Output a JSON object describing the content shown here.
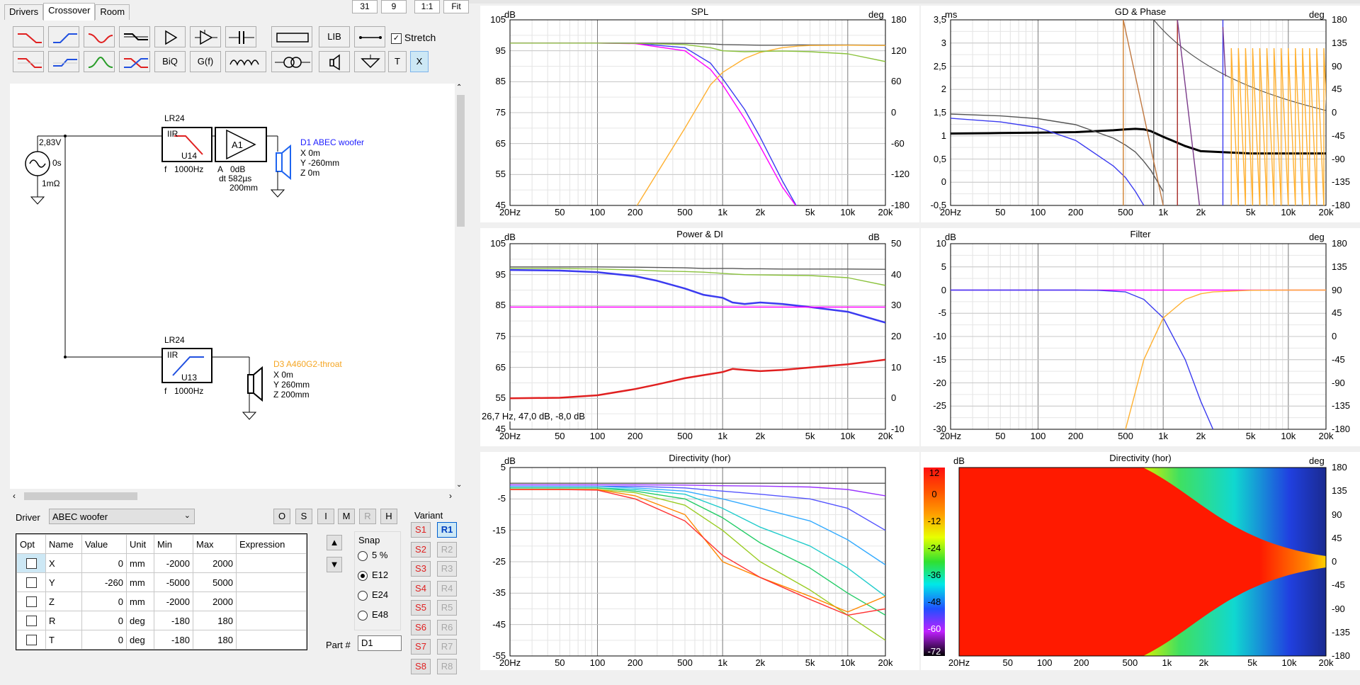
{
  "tabs": [
    "Drivers",
    "Crossover",
    "Room"
  ],
  "active_tab": "Crossover",
  "top_buttons": [
    "31",
    "9",
    "1:1",
    "Fit"
  ],
  "toolbar": {
    "row1": [
      "lowpass-icon",
      "highpass-icon",
      "bandstop-icon",
      "allpass-icon",
      "amplifier-icon",
      "buffer-icon",
      "capacitor-icon",
      "resistor-icon",
      "LIB",
      "wire-icon"
    ],
    "row2": [
      "lowpass2-icon",
      "shelf-icon",
      "bandpass-icon",
      "crossover-x-icon",
      "BiQ",
      "G(f)",
      "inductor-icon",
      "transformer-icon",
      "speaker-icon",
      "ground-icon",
      "T",
      "X"
    ],
    "stretch_label": "Stretch",
    "stretch_checked": true
  },
  "schematic": {
    "source": {
      "voltage": "2,83V",
      "delay": "0s",
      "impedance": "1mΩ"
    },
    "filter1": {
      "type": "LR24",
      "kind": "IIR",
      "unit": "U14",
      "freq_label": "f",
      "freq": "1000Hz"
    },
    "amp": {
      "label": "A1",
      "gain_label": "A",
      "gain": "0dB",
      "delay": "dt 582µs",
      "dist": "200mm"
    },
    "driver1": {
      "name": "D1 ABEC woofer",
      "x": "X 0m",
      "y": "Y -260mm",
      "z": "Z 0m",
      "color": "#0000ff"
    },
    "filter2": {
      "type": "LR24",
      "kind": "IIR",
      "unit": "U13",
      "freq_label": "f",
      "freq": "1000Hz"
    },
    "driver2": {
      "name": "D3 A460G2-throat",
      "x": "X 0m",
      "y": "Y 260mm",
      "z": "Z 200mm",
      "color": "#f5a623"
    }
  },
  "driver_select": {
    "label": "Driver",
    "value": "ABEC woofer"
  },
  "mode_buttons": [
    "O",
    "S",
    "I",
    "M",
    "R",
    "H"
  ],
  "params": {
    "headers": [
      "Opt",
      "Name",
      "Value",
      "Unit",
      "Min",
      "Max",
      "Expression"
    ],
    "rows": [
      {
        "name": "X",
        "value": "0",
        "unit": "mm",
        "min": "-2000",
        "max": "2000"
      },
      {
        "name": "Y",
        "value": "-260",
        "unit": "mm",
        "min": "-5000",
        "max": "5000"
      },
      {
        "name": "Z",
        "value": "0",
        "unit": "mm",
        "min": "-2000",
        "max": "2000"
      },
      {
        "name": "R",
        "value": "0",
        "unit": "deg",
        "min": "-180",
        "max": "180"
      },
      {
        "name": "T",
        "value": "0",
        "unit": "deg",
        "min": "-180",
        "max": "180"
      }
    ]
  },
  "snap": {
    "label": "Snap",
    "options": [
      "5 %",
      "E12",
      "E24",
      "E48"
    ],
    "selected": "E12"
  },
  "part": {
    "label": "Part #",
    "value": "D1"
  },
  "variant": {
    "label": "Variant",
    "s": [
      "S1",
      "S2",
      "S3",
      "S4",
      "S5",
      "S6",
      "S7",
      "S8"
    ],
    "r": [
      "R1",
      "R2",
      "R3",
      "R4",
      "R5",
      "R6",
      "R7",
      "R8"
    ],
    "active_r": "R1"
  },
  "freq_ticks": [
    "20Hz",
    "50",
    "100",
    "200",
    "500",
    "1k",
    "2k",
    "5k",
    "10k",
    "20k"
  ],
  "colors": {
    "blue": "#3b3bf0",
    "magenta": "#ff00ff",
    "orange": "#ffb030",
    "green": "#8ac23c",
    "gray": "#555555",
    "red": "#e02020"
  },
  "chart_data": [
    {
      "type": "line",
      "title": "SPL",
      "ylabel": "dB",
      "y2label": "deg",
      "ylim": [
        45,
        105
      ],
      "y_ticks": [
        "105",
        "95",
        "85",
        "75",
        "65",
        "55",
        "45"
      ],
      "y2lim": [
        -180,
        180
      ],
      "y2_ticks": [
        "180",
        "120",
        "60",
        "0",
        "-60",
        "-120",
        "-180"
      ],
      "x": [
        20,
        50,
        100,
        200,
        500,
        800,
        1000,
        1500,
        2000,
        3000,
        4000,
        5000,
        10000,
        20000
      ],
      "series": [
        {
          "color": "#555555",
          "values": [
            97.5,
            97.5,
            97.5,
            97.5,
            97.4,
            97.2,
            97,
            96.9,
            96.8,
            96.8,
            96.9,
            96.9,
            96.9,
            96.8
          ]
        },
        {
          "color": "#3b3bf0",
          "values": [
            97.5,
            97.5,
            97.5,
            97.4,
            96,
            91,
            86,
            76,
            67,
            53,
            44,
            null,
            null,
            null
          ]
        },
        {
          "color": "#ff00ff",
          "values": [
            97.5,
            97.5,
            97.5,
            97.3,
            95,
            89,
            84,
            73,
            64,
            51,
            44,
            null,
            null,
            null
          ]
        },
        {
          "color": "#ffb030",
          "values": [
            null,
            null,
            null,
            44,
            70,
            84,
            88,
            92.5,
            94.5,
            96,
            96.5,
            96.7,
            96.8,
            96.7
          ]
        },
        {
          "color": "#8ac23c",
          "values": [
            97.5,
            97.5,
            97.5,
            97.4,
            97,
            96,
            95,
            94.7,
            94.8,
            94.9,
            94.8,
            94.7,
            94,
            91.5
          ]
        }
      ]
    },
    {
      "type": "line",
      "title": "GD & Phase",
      "ylabel": "ms",
      "y2label": "deg",
      "ylim": [
        -0.5,
        3.5
      ],
      "y_ticks": [
        "3,5",
        "3",
        "2,5",
        "2",
        "1,5",
        "1",
        "0,5",
        "0",
        "-0,5"
      ],
      "y2lim": [
        -180,
        180
      ],
      "y2_ticks": [
        "180",
        "135",
        "90",
        "45",
        "0",
        "-45",
        "-90",
        "-135",
        "-180"
      ],
      "x": [
        20,
        50,
        100,
        200,
        400,
        500,
        600,
        700,
        800,
        1000,
        1500,
        2000,
        5000,
        10000,
        20000
      ],
      "series": [
        {
          "color": "#000000",
          "values": [
            1.05,
            1.06,
            1.07,
            1.08,
            1.12,
            1.14,
            1.15,
            1.14,
            1.1,
            0.98,
            0.78,
            0.67,
            0.62,
            0.62,
            0.62
          ]
        },
        {
          "color": "#555555",
          "values": [
            1.47,
            1.43,
            1.37,
            1.24,
            0.95,
            0.8,
            0.65,
            0.45,
            0.25,
            -0.2,
            null,
            null,
            null,
            null,
            null
          ]
        },
        {
          "color": "#3b3bf0",
          "values": [
            1.38,
            1.3,
            1.18,
            0.9,
            0.35,
            0.1,
            -0.2,
            -0.5,
            null,
            null,
            null,
            null,
            null,
            null,
            null
          ]
        }
      ]
    },
    {
      "type": "line",
      "title": "Power & DI",
      "ylabel": "dB",
      "y2label": "dB",
      "ylim": [
        45,
        105
      ],
      "y_ticks": [
        "105",
        "95",
        "85",
        "75",
        "65",
        "55",
        "45"
      ],
      "y2lim": [
        -10,
        50
      ],
      "y2_ticks": [
        "50",
        "40",
        "30",
        "20",
        "10",
        "0",
        "-10"
      ],
      "cursor_readout": "26,7 Hz, 47,0 dB, -8,0 dB",
      "x": [
        20,
        50,
        100,
        200,
        300,
        500,
        700,
        1000,
        1200,
        1500,
        2000,
        3000,
        5000,
        10000,
        20000
      ],
      "series": [
        {
          "color": "#555555",
          "values": [
            97.5,
            97.5,
            97.5,
            97.4,
            97.3,
            97.2,
            97,
            97,
            97,
            96.9,
            96.9,
            96.8,
            96.8,
            96.8,
            96.7
          ]
        },
        {
          "color": "#8ac23c",
          "values": [
            97,
            97,
            96.8,
            96.5,
            96.2,
            96,
            95.8,
            95.4,
            95.2,
            95,
            94.9,
            94.8,
            94.7,
            94,
            91.5
          ]
        },
        {
          "color": "#3b3bf0",
          "values": [
            96.5,
            96.3,
            95.8,
            94.5,
            93,
            90.5,
            88.5,
            87.5,
            86,
            85.5,
            86,
            85.5,
            84.5,
            83,
            79.5
          ]
        },
        {
          "color": "#ff00ff",
          "values": [
            84.5,
            84.5,
            84.5,
            84.5,
            84.5,
            84.5,
            84.5,
            84.5,
            84.5,
            84.5,
            84.5,
            84.5,
            84.5,
            84.5,
            84.5
          ]
        },
        {
          "color": "#e02020",
          "values": [
            55,
            55.2,
            56,
            58,
            59.5,
            61.5,
            62.5,
            63.5,
            64.5,
            64.2,
            63.8,
            64.2,
            65,
            66,
            67.5
          ]
        }
      ]
    },
    {
      "type": "line",
      "title": "Filter",
      "ylabel": "dB",
      "y2label": "deg",
      "ylim": [
        -30,
        10
      ],
      "y_ticks": [
        "10",
        "5",
        "0",
        "-5",
        "-10",
        "-15",
        "-20",
        "-25",
        "-30"
      ],
      "y2lim": [
        -180,
        180
      ],
      "y2_ticks": [
        "180",
        "135",
        "90",
        "45",
        "0",
        "-45",
        "-90",
        "-135",
        "-180"
      ],
      "x": [
        20,
        50,
        100,
        200,
        300,
        500,
        700,
        1000,
        1500,
        2000,
        2500,
        5000,
        10000,
        20000
      ],
      "series": [
        {
          "color": "#ff00ff",
          "values": [
            0,
            0,
            0,
            0,
            0,
            0,
            0,
            0,
            0,
            0,
            0,
            0,
            0,
            0
          ]
        },
        {
          "color": "#3b3bf0",
          "values": [
            0,
            0,
            0,
            0,
            -0.05,
            -0.4,
            -2,
            -6,
            -15,
            -24,
            -30,
            null,
            null,
            null
          ]
        },
        {
          "color": "#ffb030",
          "values": [
            null,
            null,
            null,
            null,
            null,
            -30,
            -15,
            -6,
            -2,
            -0.8,
            -0.4,
            -0.05,
            0,
            0
          ]
        }
      ]
    },
    {
      "type": "line",
      "title": "Directivity (hor)",
      "ylabel": "dB",
      "ylim": [
        -55,
        5
      ],
      "y_ticks": [
        "5",
        "-5",
        "-15",
        "-25",
        "-35",
        "-45",
        "-55"
      ],
      "x": [
        20,
        50,
        100,
        200,
        500,
        1000,
        2000,
        5000,
        10000,
        20000
      ],
      "series": [
        {
          "color": "#555555",
          "values": [
            0,
            0,
            0,
            0,
            0,
            0,
            0,
            0,
            0,
            0
          ]
        },
        {
          "color": "#9933ff",
          "values": [
            -0.5,
            -0.5,
            -0.5,
            -0.5,
            -0.6,
            -0.8,
            -0.9,
            -1.2,
            -2,
            -4
          ]
        },
        {
          "color": "#5555ff",
          "values": [
            -1,
            -1,
            -1,
            -1,
            -1.5,
            -2.5,
            -3.5,
            -5,
            -8,
            -15
          ]
        },
        {
          "color": "#33aaff",
          "values": [
            -1,
            -1,
            -1,
            -1.5,
            -2.5,
            -5,
            -8,
            -12,
            -18,
            -26
          ]
        },
        {
          "color": "#22cccc",
          "values": [
            -1.5,
            -1.5,
            -1.5,
            -2,
            -3.5,
            -8,
            -14,
            -20,
            -27,
            -36
          ]
        },
        {
          "color": "#22cc66",
          "values": [
            -1.5,
            -1.5,
            -1.5,
            -2.5,
            -5,
            -11,
            -19,
            -27,
            -35,
            -42
          ]
        },
        {
          "color": "#99cc22",
          "values": [
            -2,
            -2,
            -2,
            -3,
            -7,
            -15,
            -25,
            -34,
            -42,
            -50
          ]
        },
        {
          "color": "#ff8800",
          "values": [
            -2,
            -2,
            -2,
            -4,
            -10,
            -25,
            -30,
            -36,
            -41,
            -36
          ]
        },
        {
          "color": "#ff3333",
          "values": [
            -2,
            -2,
            -2.2,
            -5,
            -12,
            -23,
            -30,
            -37,
            -42,
            -40
          ]
        }
      ]
    },
    {
      "type": "heatmap",
      "title": "Directivity (hor)",
      "ylabel": "dB",
      "y2label": "deg",
      "colorbar_ticks": [
        "12",
        "0",
        "-12",
        "-24",
        "-36",
        "-48",
        "-60",
        "-72"
      ],
      "y2_ticks": [
        "180",
        "135",
        "90",
        "45",
        "0",
        "-45",
        "-90",
        "-135",
        "-180"
      ],
      "x_ticks": [
        "20Hz",
        "50",
        "100",
        "200",
        "500",
        "1k",
        "2k",
        "5k",
        "10k",
        "20k"
      ]
    }
  ]
}
